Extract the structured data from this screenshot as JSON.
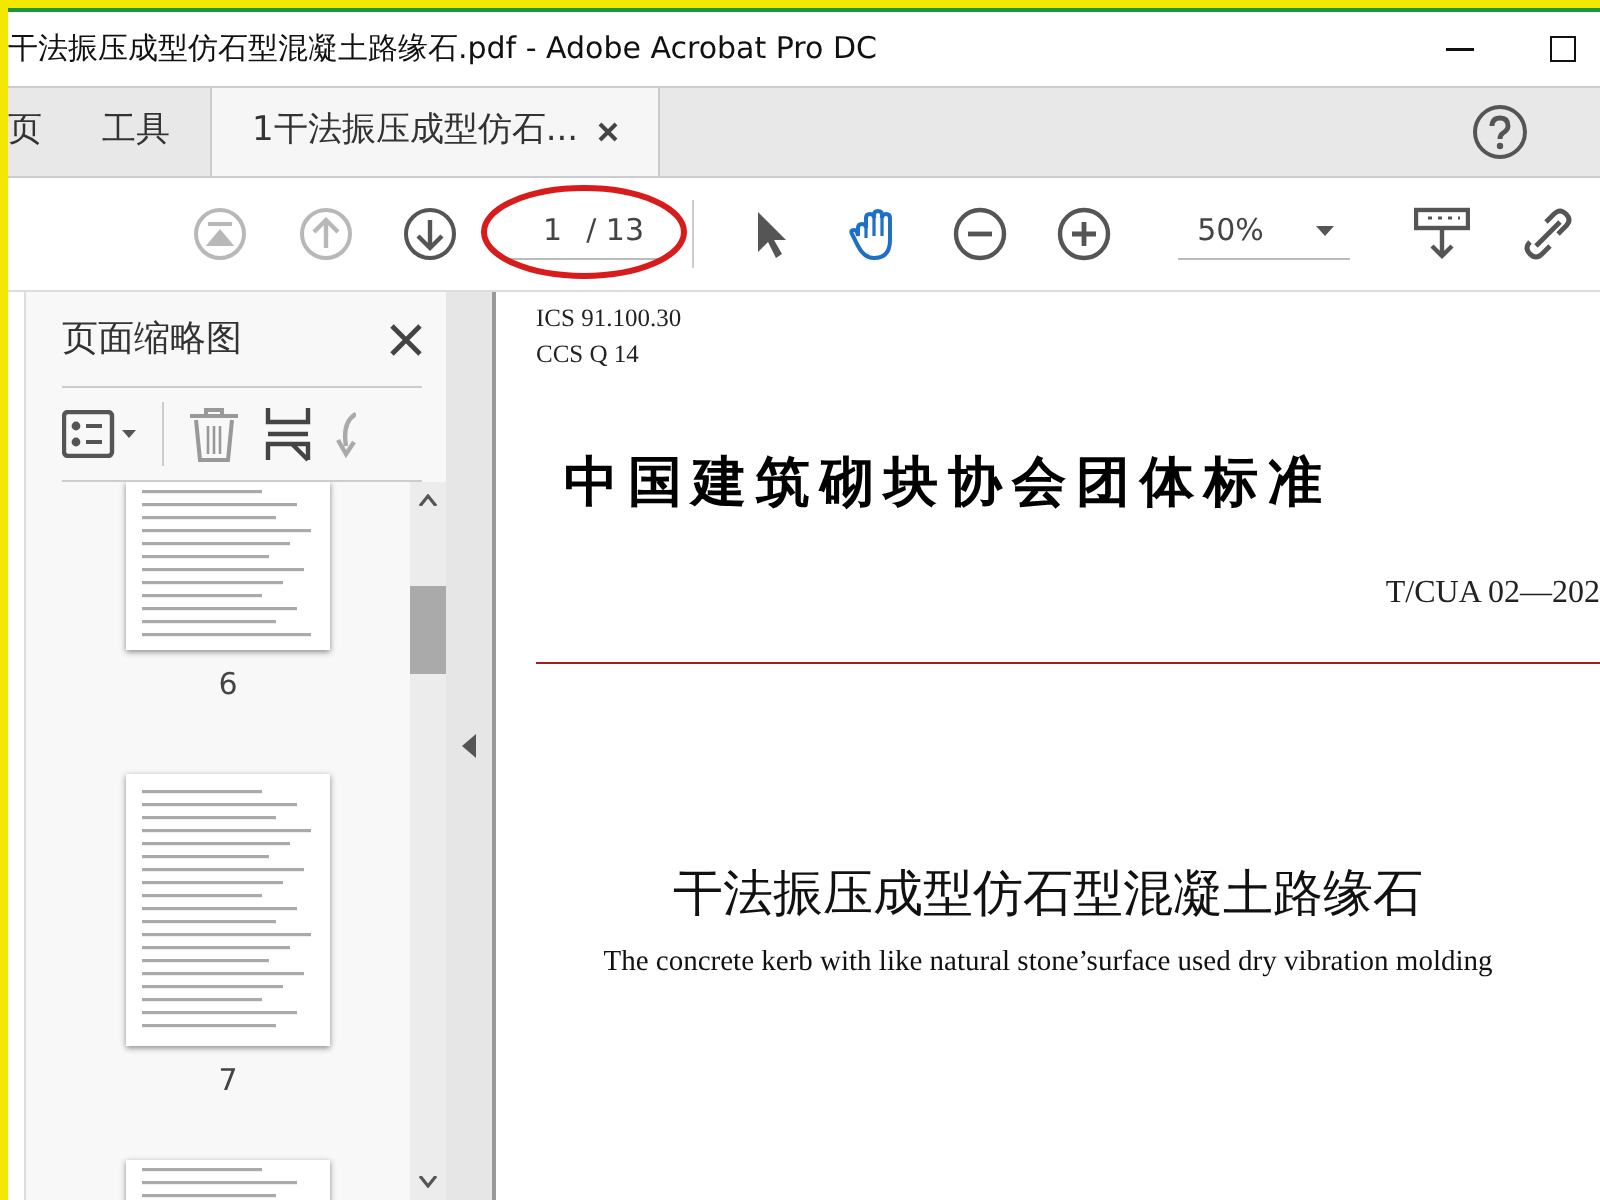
{
  "window": {
    "title": "干法振压成型仿石型混凝土路缘石.pdf - Adobe Acrobat Pro DC"
  },
  "tabs": [
    {
      "label": "页",
      "selected": false
    },
    {
      "label": "工具",
      "selected": false
    },
    {
      "label": "1干法振压成型仿石...",
      "selected": true
    }
  ],
  "toolbar": {
    "tools": [
      {
        "kind": "first",
        "disabled": true,
        "selected": false
      },
      {
        "kind": "prev",
        "disabled": true,
        "selected": false
      },
      {
        "kind": "next",
        "disabled": false,
        "selected": false
      },
      {
        "kind": "page",
        "current": "1",
        "total": "/ 13"
      },
      {
        "kind": "select",
        "disabled": false,
        "selected": false
      },
      {
        "kind": "hand",
        "disabled": false,
        "selected": true
      },
      {
        "kind": "zoomout",
        "disabled": false,
        "selected": false
      },
      {
        "kind": "zoomin",
        "disabled": false,
        "selected": false
      },
      {
        "kind": "zoom",
        "value": "50%"
      },
      {
        "kind": "scroll",
        "disabled": false,
        "selected": false
      },
      {
        "kind": "link",
        "disabled": false,
        "selected": false
      }
    ]
  },
  "sidebar": {
    "title": "页面缩略图",
    "thumbnails": [
      {
        "label": "6"
      },
      {
        "label": "7"
      }
    ]
  },
  "document": {
    "lines": [
      {
        "kind": "code",
        "text": "ICS 91.100.30"
      },
      {
        "kind": "code",
        "text": "CCS Q 14"
      },
      {
        "kind": "heading",
        "text": "中国建筑砌块协会团体标准"
      },
      {
        "kind": "number",
        "text": "T/CUA  02—202"
      },
      {
        "kind": "rule"
      },
      {
        "kind": "title",
        "text": "干法振压成型仿石型混凝土路缘石"
      },
      {
        "kind": "subtitle",
        "text": "The concrete kerb with like natural stone’surface used dry vibration molding"
      }
    ]
  }
}
